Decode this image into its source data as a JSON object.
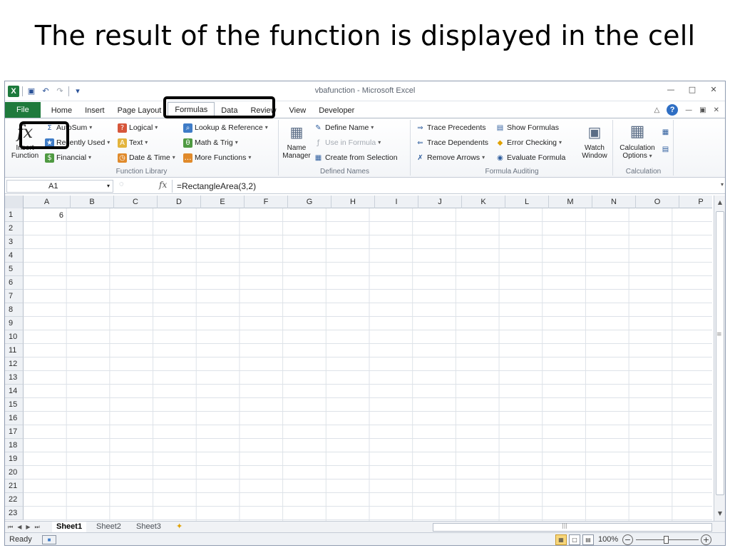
{
  "slide": {
    "title": "The result of the function is displayed in the cell"
  },
  "window": {
    "title": "vbafunction - Microsoft Excel"
  },
  "tabs": [
    "File",
    "Home",
    "Insert",
    "Page Layout",
    "Formulas",
    "Data",
    "Review",
    "View",
    "Developer"
  ],
  "ribbon": {
    "function_library": {
      "label": "Function Library",
      "insert_function": "Insert Function",
      "autosum": "AutoSum",
      "recently_used": "Recently Used",
      "financial": "Financial",
      "logical": "Logical",
      "text": "Text",
      "date_time": "Date & Time",
      "lookup_reference": "Lookup & Reference",
      "math_trig": "Math & Trig",
      "more_functions": "More Functions"
    },
    "defined_names": {
      "label": "Defined Names",
      "name_manager": "Name Manager",
      "define_name": "Define Name",
      "use_in_formula": "Use in Formula",
      "create_from_selection": "Create from Selection"
    },
    "formula_auditing": {
      "label": "Formula Auditing",
      "trace_precedents": "Trace Precedents",
      "trace_dependents": "Trace Dependents",
      "remove_arrows": "Remove Arrows",
      "show_formulas": "Show Formulas",
      "error_checking": "Error Checking",
      "evaluate_formula": "Evaluate Formula",
      "watch_window": "Watch Window"
    },
    "calculation": {
      "label": "Calculation",
      "calculation_options": "Calculation Options"
    }
  },
  "formula_bar": {
    "name_box": "A1",
    "fx": "fx",
    "formula": "=RectangleArea(3,2)"
  },
  "grid": {
    "columns": [
      "A",
      "B",
      "C",
      "D",
      "E",
      "F",
      "G",
      "H",
      "I",
      "J",
      "K",
      "L",
      "M",
      "N",
      "O",
      "P"
    ],
    "rows": [
      "1",
      "2",
      "3",
      "4",
      "5",
      "6",
      "7",
      "8",
      "9",
      "10",
      "11",
      "12",
      "13",
      "14",
      "15",
      "16",
      "17",
      "18",
      "19",
      "20",
      "21",
      "22",
      "23"
    ],
    "cell_a1": "6"
  },
  "sheets": [
    "Sheet1",
    "Sheet2",
    "Sheet3"
  ],
  "status": {
    "ready": "Ready",
    "zoom": "100%"
  },
  "colors": {
    "file_tab": "#1f7a3c",
    "highlight_border": "#000000"
  }
}
